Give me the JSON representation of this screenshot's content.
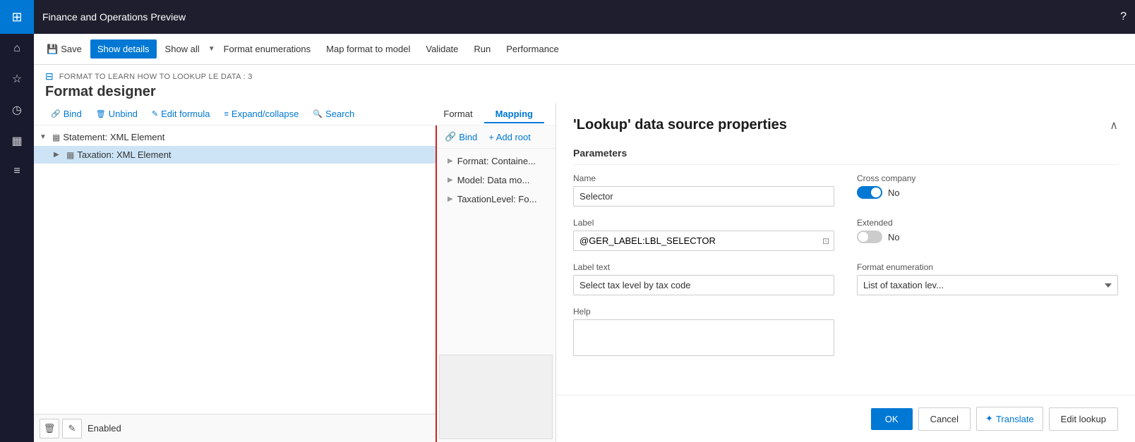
{
  "app": {
    "title": "Finance and Operations Preview",
    "help_icon": "?"
  },
  "sidebar": {
    "items": [
      {
        "name": "grid-icon",
        "icon": "⊞",
        "label": "Apps"
      },
      {
        "name": "home-icon",
        "icon": "⌂",
        "label": "Home"
      },
      {
        "name": "star-icon",
        "icon": "☆",
        "label": "Favorites"
      },
      {
        "name": "clock-icon",
        "icon": "◷",
        "label": "Recent"
      },
      {
        "name": "calendar-icon",
        "icon": "▦",
        "label": "Workspaces"
      },
      {
        "name": "list-icon",
        "icon": "≡",
        "label": "Modules"
      }
    ]
  },
  "toolbar": {
    "save_label": "Save",
    "show_details_label": "Show details",
    "show_all_label": "Show all",
    "format_enumerations_label": "Format enumerations",
    "map_format_label": "Map format to model",
    "validate_label": "Validate",
    "run_label": "Run",
    "performance_label": "Performance"
  },
  "page": {
    "breadcrumb": "FORMAT TO LEARN HOW TO LOOKUP LE DATA : 3",
    "title": "Format designer"
  },
  "action_toolbar": {
    "bind_label": "Bind",
    "unbind_label": "Unbind",
    "edit_formula_label": "Edit formula",
    "expand_collapse_label": "Expand/collapse",
    "search_label": "Search"
  },
  "tree": {
    "items": [
      {
        "label": "Statement: XML Element",
        "level": 0,
        "expanded": true,
        "selected": false
      },
      {
        "label": "Taxation: XML Element",
        "level": 1,
        "expanded": false,
        "selected": true
      }
    ]
  },
  "tabs": {
    "format_label": "Format",
    "mapping_label": "Mapping"
  },
  "mapping": {
    "bind_label": "Bind",
    "add_root_label": "+ Add root",
    "items": [
      {
        "label": "Format: Containe..."
      },
      {
        "label": "Model: Data mo..."
      },
      {
        "label": "TaxationLevel: Fo..."
      }
    ]
  },
  "bottom": {
    "enabled_label": "Enabled",
    "delete_icon": "🗑",
    "edit_icon": "✎"
  },
  "right_panel": {
    "title": "'Lookup' data source properties",
    "collapse_icon": "∧",
    "section_title": "Parameters",
    "name_label": "Name",
    "name_value": "Selector",
    "label_label": "Label",
    "label_value": "@GER_LABEL:LBL_SELECTOR",
    "label_icon": "⊡",
    "label_text_label": "Label text",
    "label_text_value": "Select tax level by tax code",
    "help_label": "Help",
    "help_value": "",
    "cross_company_label": "Cross company",
    "cross_company_value": "No",
    "extended_label": "Extended",
    "extended_value": "No",
    "format_enum_label": "Format enumeration",
    "format_enum_value": "List of taxation lev...",
    "buttons": {
      "ok_label": "OK",
      "cancel_label": "Cancel",
      "translate_label": "Translate",
      "edit_lookup_label": "Edit lookup"
    }
  }
}
